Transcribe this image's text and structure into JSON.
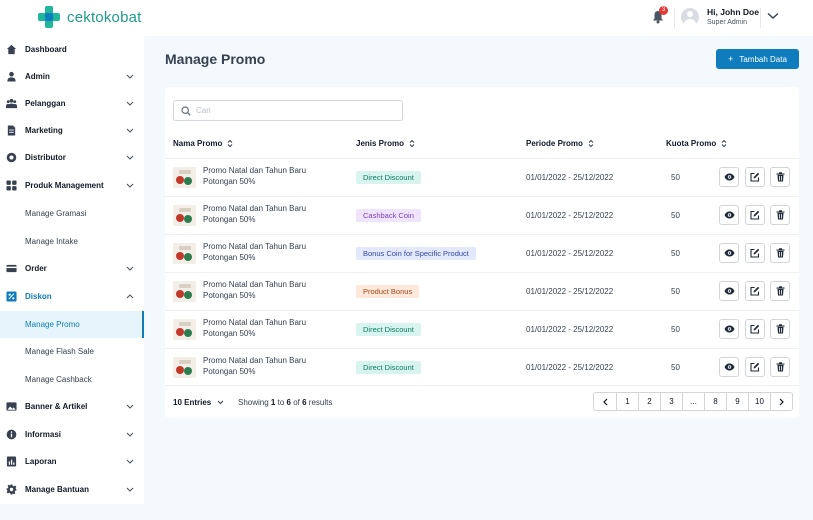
{
  "brand": {
    "name": "cektokobat"
  },
  "header": {
    "notifications": "3",
    "user_name": "Hi, John Doe",
    "user_role": "Super Admin"
  },
  "sidebar": {
    "items": [
      {
        "label": "Dashboard",
        "icon": "home-icon"
      },
      {
        "label": "Admin",
        "icon": "user-icon"
      },
      {
        "label": "Pelanggan",
        "icon": "users-icon"
      },
      {
        "label": "Marketing",
        "icon": "document-icon"
      },
      {
        "label": "Distributor",
        "icon": "circle-icon"
      },
      {
        "label": "Produk Management",
        "icon": "grid-icon"
      },
      {
        "label": "Manage Gramasi"
      },
      {
        "label": "Manage Intake"
      },
      {
        "label": "Order",
        "icon": "card-icon"
      },
      {
        "label": "Diskon",
        "icon": "discount-icon"
      },
      {
        "label": "Manage Promo"
      },
      {
        "label": "Manage Flash Sale"
      },
      {
        "label": "Manage Cashback"
      },
      {
        "label": "Banner & Artikel",
        "icon": "image-icon"
      },
      {
        "label": "Informasi",
        "icon": "info-icon"
      },
      {
        "label": "Laporan",
        "icon": "report-icon"
      },
      {
        "label": "Manage Bantuan",
        "icon": "gear-icon"
      }
    ]
  },
  "main": {
    "title": "Manage Promo",
    "add_label": "Tambah Data",
    "search_placeholder": "Cari",
    "columns": [
      "Nama Promo",
      "Jenis Promo",
      "Periode Promo",
      "Kuota Promo"
    ],
    "rows": [
      {
        "name": "Promo Natal dan Tahun Baru Potongan 50%",
        "type": "Direct Discount",
        "period": "01/01/2022 - 25/12/2022",
        "quota": "50"
      },
      {
        "name": "Promo Natal dan Tahun Baru Potongan 50%",
        "type": "Cashback Coin",
        "period": "01/01/2022 - 25/12/2022",
        "quota": "50"
      },
      {
        "name": "Promo Natal dan Tahun Baru Potongan 50%",
        "type": "Bonus Coin for Specific Product",
        "period": "01/01/2022 - 25/12/2022",
        "quota": "50"
      },
      {
        "name": "Promo Natal dan Tahun Baru Potongan 50%",
        "type": "Product Bonus",
        "period": "01/01/2022 - 25/12/2022",
        "quota": "50"
      },
      {
        "name": "Promo Natal dan Tahun Baru Potongan 50%",
        "type": "Direct Discount",
        "period": "01/01/2022 - 25/12/2022",
        "quota": "50"
      },
      {
        "name": "Promo Natal dan Tahun Baru Potongan 50%",
        "type": "Direct Discount",
        "period": "01/01/2022 - 25/12/2022",
        "quota": "50"
      }
    ],
    "footer": {
      "entries": "10 Entries",
      "showing_prefix": "Showing",
      "from": "1",
      "to_word": "to",
      "to": "6",
      "of_word": "of",
      "total": "6",
      "suffix": "results"
    },
    "pagination": [
      "1",
      "2",
      "3",
      "...",
      "8",
      "9",
      "10"
    ]
  },
  "colors": {
    "primary": "#0f7dbd",
    "brand_green": "#1fb89b"
  }
}
